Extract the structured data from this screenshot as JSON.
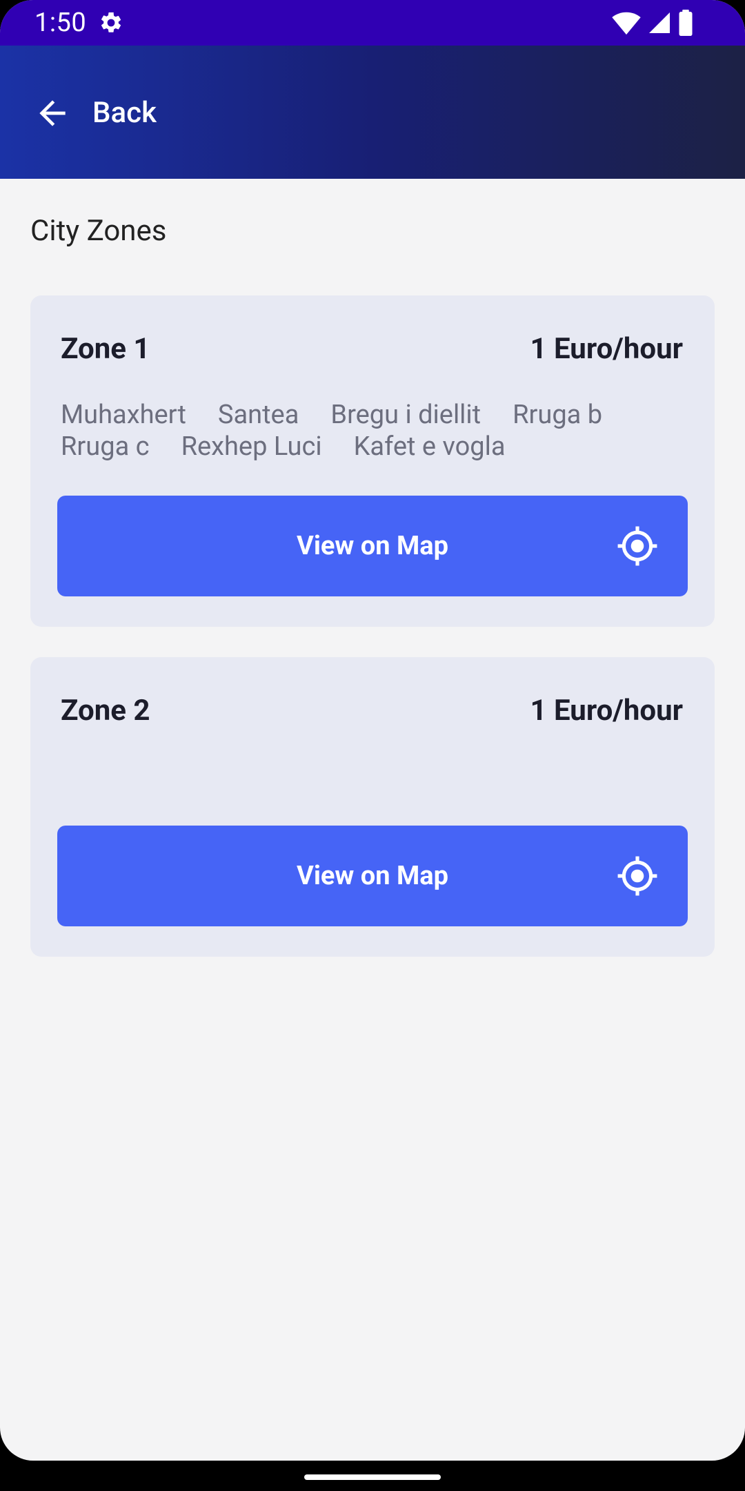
{
  "status_bar": {
    "time": "1:50",
    "icons": [
      "settings-gear-icon",
      "wifi-icon",
      "signal-icon",
      "battery-icon"
    ]
  },
  "app_bar": {
    "back_label": "Back",
    "back_icon": "arrow-left-icon"
  },
  "page": {
    "title": "City Zones"
  },
  "zones": [
    {
      "name": "Zone 1",
      "price": "1 Euro/hour",
      "streets": [
        "Muhaxhert",
        "Santea",
        "Bregu i diellit",
        "Rruga b",
        "Rruga c",
        "Rexhep Luci",
        "Kafet e vogla"
      ],
      "button_label": "View on Map",
      "button_icon": "location-target-icon"
    },
    {
      "name": "Zone 2",
      "price": "1 Euro/hour",
      "streets": [],
      "button_label": "View on Map",
      "button_icon": "location-target-icon"
    }
  ],
  "colors": {
    "status_bar": "#3000b3",
    "app_bar_gradient": [
      "#1b32a6",
      "#181f74",
      "#1c2145"
    ],
    "background": "#f4f4f5",
    "card": "#e7e9f3",
    "button": "#4664f6",
    "text_primary": "#1c1d2b",
    "text_secondary": "#6c6e7e"
  }
}
